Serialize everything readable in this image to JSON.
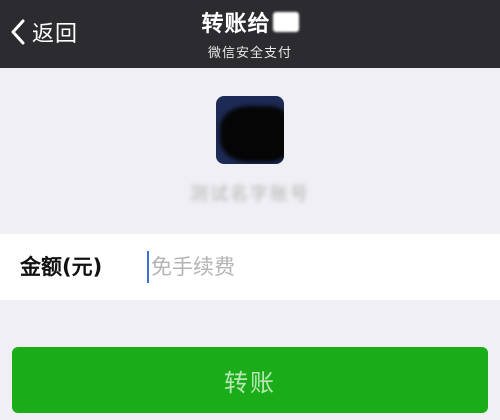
{
  "header": {
    "back_label": "返回",
    "title": "转账给",
    "subtitle": "微信安全支付",
    "background": "#2c2c30"
  },
  "recipient": {
    "name": "测试名字账号"
  },
  "amount": {
    "label": "金额(元)",
    "placeholder": "免手续费",
    "value": ""
  },
  "actions": {
    "transfer_label": "转账",
    "accent": "#1aad19"
  },
  "icons": {
    "back": "chevron-left-icon"
  }
}
